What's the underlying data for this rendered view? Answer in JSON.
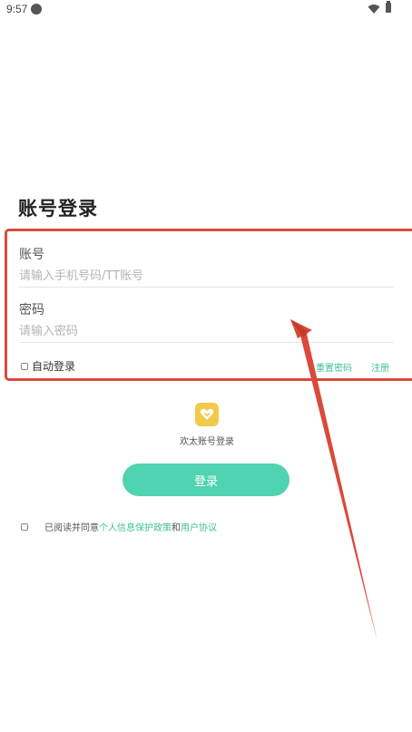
{
  "status_bar": {
    "time": "9:57"
  },
  "page": {
    "title": "账号登录"
  },
  "form": {
    "account_label": "账号",
    "account_placeholder": "请输入手机号码/TT账号",
    "password_label": "密码",
    "password_placeholder": "请输入密码",
    "auto_login_label": "自动登录",
    "reset_password": "重置密码",
    "register": "注册"
  },
  "alt_login": {
    "label": "欢太账号登录",
    "icon": "heart-badge-icon"
  },
  "login_button": {
    "label": "登录"
  },
  "agreement": {
    "prefix": "已阅读并同意",
    "privacy_link": "个人信息保护政策",
    "conjunction": "和",
    "terms_link": "用户协议"
  },
  "colors": {
    "accent": "#4fd3b0",
    "link": "#3fbf9b",
    "highlight": "#d94a3a",
    "alt_icon": "#f3c94a"
  }
}
